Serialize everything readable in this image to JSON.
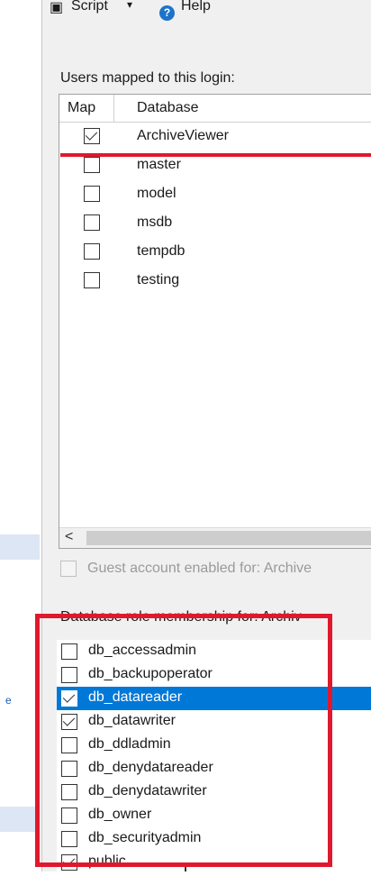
{
  "toolbar": {
    "script_label": "Script",
    "help_label": "Help",
    "dropdown_arrow": "▾",
    "help_icon": "question-circle-icon"
  },
  "users_section": {
    "label": "Users mapped to this login:",
    "columns": [
      "Map",
      "Database"
    ]
  },
  "users": [
    {
      "map": true,
      "database": "ArchiveViewer"
    },
    {
      "map": false,
      "database": "master"
    },
    {
      "map": false,
      "database": "model"
    },
    {
      "map": false,
      "database": "msdb"
    },
    {
      "map": false,
      "database": "tempdb"
    },
    {
      "map": false,
      "database": "testing"
    }
  ],
  "scroll_left_glyph": "<",
  "guest": {
    "label": "Guest account enabled for: Archive",
    "checked": false,
    "enabled": false
  },
  "roles_section": {
    "label": "Database role membership for: Archiv"
  },
  "roles": [
    {
      "label": "db_accessadmin",
      "checked": false,
      "selected": false
    },
    {
      "label": "db_backupoperator",
      "checked": false,
      "selected": false
    },
    {
      "label": "db_datareader",
      "checked": true,
      "selected": true
    },
    {
      "label": "db_datawriter",
      "checked": true,
      "selected": false
    },
    {
      "label": "db_ddladmin",
      "checked": false,
      "selected": false
    },
    {
      "label": "db_denydatareader",
      "checked": false,
      "selected": false
    },
    {
      "label": "db_denydatawriter",
      "checked": false,
      "selected": false
    },
    {
      "label": "db_owner",
      "checked": false,
      "selected": false
    },
    {
      "label": "db_securityadmin",
      "checked": false,
      "selected": false
    },
    {
      "label": "public",
      "checked": true,
      "selected": false
    }
  ],
  "colors": {
    "selection": "#0078d7",
    "annotation_red": "#e0182d",
    "panel_bg": "#f0f0f0"
  },
  "left_strip_char": "e"
}
